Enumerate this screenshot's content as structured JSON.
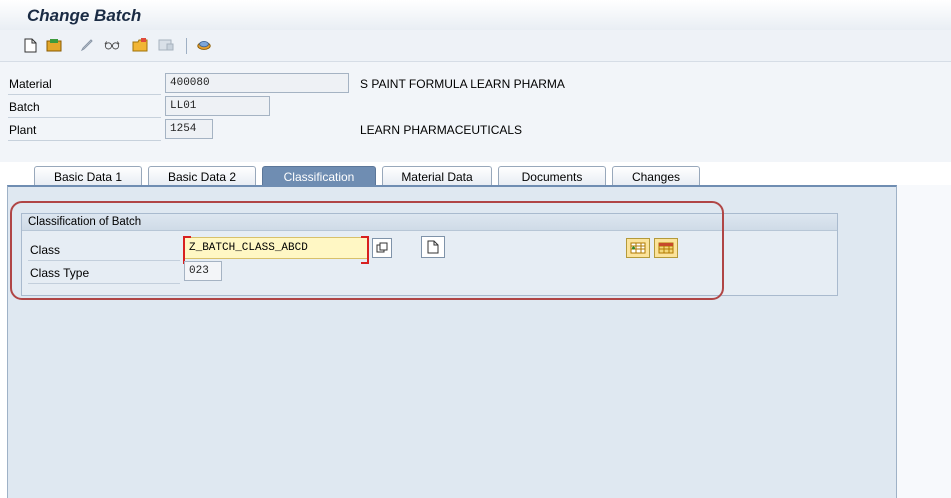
{
  "window": {
    "title": "Change Batch"
  },
  "toolbar": {
    "icons": [
      "new-document-icon",
      "change-icon",
      "pencil-icon",
      "glasses-icon",
      "folder-icon",
      "save-disabled-icon",
      "other-icon"
    ]
  },
  "header": {
    "material_label": "Material",
    "material_value": "400080",
    "material_desc": "S PAINT FORMULA LEARN PHARMA",
    "batch_label": "Batch",
    "batch_value": "LL01",
    "plant_label": "Plant",
    "plant_value": "1254",
    "plant_desc": "LEARN PHARMACEUTICALS"
  },
  "tabs": [
    {
      "label": "Basic Data 1"
    },
    {
      "label": "Basic Data 2"
    },
    {
      "label": "Classification",
      "active": true
    },
    {
      "label": "Material Data"
    },
    {
      "label": "Documents"
    },
    {
      "label": "Changes"
    }
  ],
  "classification": {
    "group_title": "Classification of Batch",
    "class_label": "Class",
    "class_value": "Z_BATCH_CLASS_ABCD",
    "class_type_label": "Class Type",
    "class_type_value": "023"
  },
  "colors": {
    "active_tab": "#6f8db2",
    "highlight": "#b04545",
    "input_focus": "#fff7c4"
  }
}
